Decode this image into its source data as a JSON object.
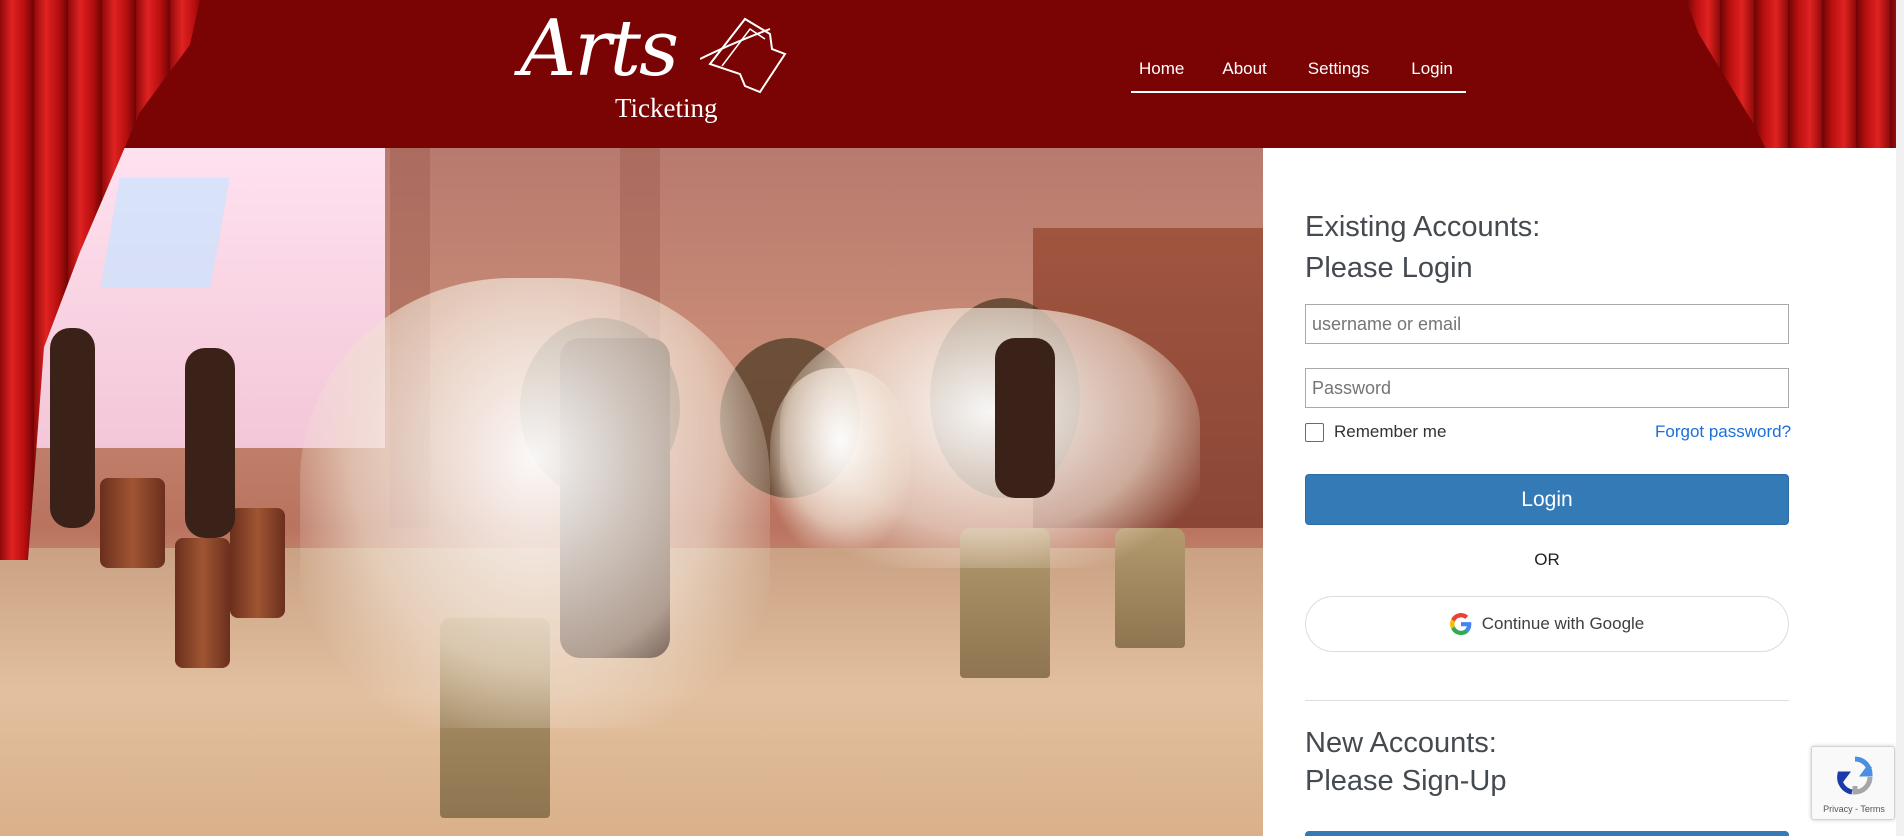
{
  "header": {
    "logo": {
      "script": "Arts",
      "sub": "Ticketing"
    },
    "nav": [
      {
        "label": "Home"
      },
      {
        "label": "About"
      },
      {
        "label": "Settings"
      },
      {
        "label": "Login"
      }
    ]
  },
  "login": {
    "heading_line1": "Existing Accounts:",
    "heading_line2": "Please Login",
    "username_placeholder": "username or email",
    "password_placeholder": "Password",
    "remember_label": "Remember me",
    "forgot_label": "Forgot password?",
    "login_button": "Login",
    "or_text": "OR",
    "google_button": "Continue with Google"
  },
  "signup": {
    "heading_line1": "New Accounts:",
    "heading_line2": "Please Sign-Up"
  },
  "recaptcha": {
    "text": "Privacy - Terms"
  },
  "colors": {
    "header_bg": "#7a0303",
    "primary_button": "#337ab7",
    "link": "#1a6fd8"
  }
}
